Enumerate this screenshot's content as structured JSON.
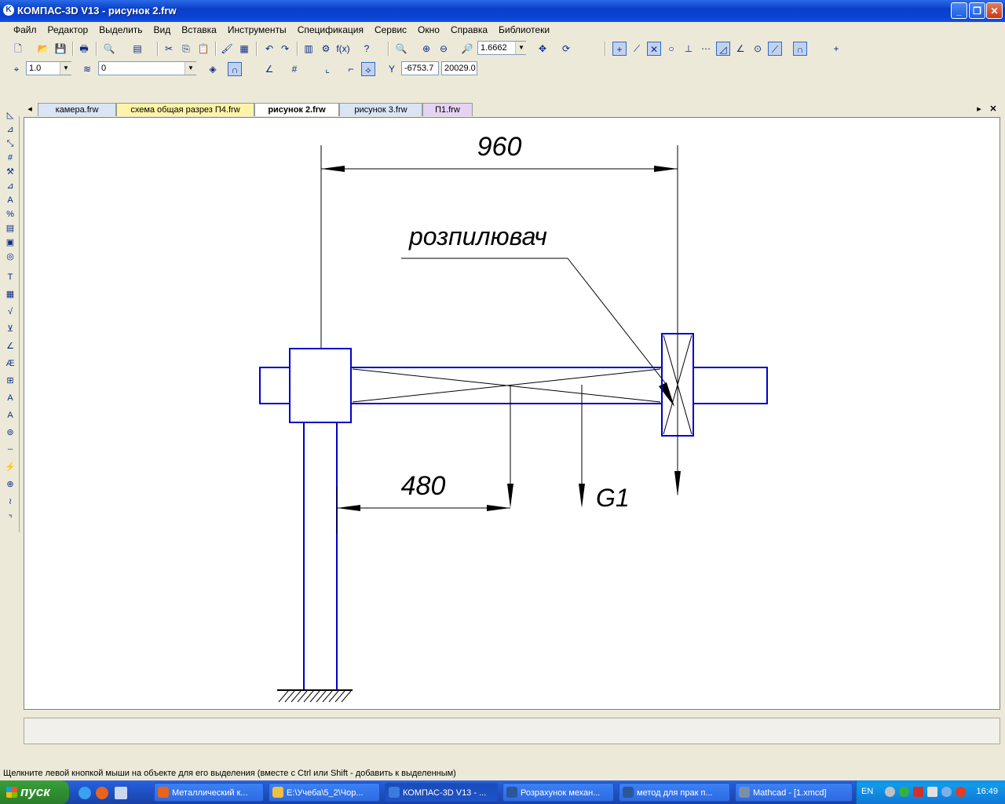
{
  "window": {
    "title": "КОМПАС-3D V13 - рисунок 2.frw",
    "app_icon": "K"
  },
  "menu": [
    "Файл",
    "Редактор",
    "Выделить",
    "Вид",
    "Вставка",
    "Инструменты",
    "Спецификация",
    "Сервис",
    "Окно",
    "Справка",
    "Библиотеки"
  ],
  "toolbar": {
    "zoom_value": "1.6662",
    "step_value": "1.0",
    "layer_value": "0",
    "coord_x": "-6753.7",
    "coord_y": "20029.0"
  },
  "tabs": [
    {
      "label": "камера.frw",
      "color": "#d9e4f5"
    },
    {
      "label": "схема общая разрез П4.frw",
      "color": "#fff3a8"
    },
    {
      "label": "рисунок 2.frw",
      "color": "#ffffff"
    },
    {
      "label": "рисунок 3.frw",
      "color": "#d9e4f5"
    },
    {
      "label": "П1.frw",
      "color": "#e6d2f2"
    }
  ],
  "drawing": {
    "dim_top": "960",
    "dim_bottom": "480",
    "label_saw": "розпилювач",
    "label_load": "G1",
    "line_color": "#0000c8"
  },
  "status_text": "Щелкните левой кнопкой мыши на объекте для его выделения (вместе с Ctrl или Shift - добавить к выделенным)",
  "taskbar": {
    "start_label": "пуск",
    "tasks": [
      {
        "label": "Металлический к...",
        "icon_color": "#e8641c"
      },
      {
        "label": "E:\\Учеба\\5_2\\Чор...",
        "icon_color": "#f0c040"
      },
      {
        "label": "КОМПАС-3D V13 - ...",
        "icon_color": "#3a7be0"
      },
      {
        "label": "Розрахунок механ...",
        "icon_color": "#2b579a"
      },
      {
        "label": "метод для прак п...",
        "icon_color": "#2b579a"
      },
      {
        "label": "Mathcad - [1.xmcd]",
        "icon_color": "#7b8fa8"
      }
    ],
    "lang": "EN",
    "clock": "16:49"
  }
}
